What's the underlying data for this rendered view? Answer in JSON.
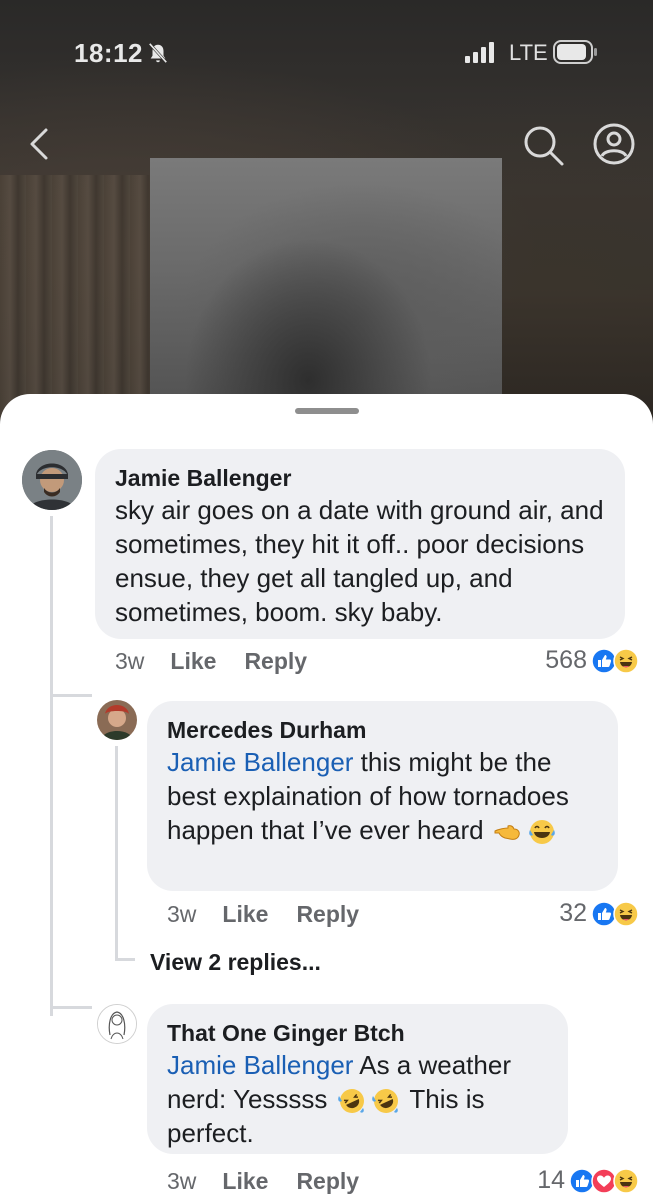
{
  "status_bar": {
    "time": "18:12",
    "network": "LTE",
    "icons": [
      "bell-muted-icon",
      "signal-icon",
      "battery-icon"
    ]
  },
  "top_nav": {
    "icons": [
      "back-chevron-icon",
      "search-icon",
      "profile-icon"
    ]
  },
  "comments": [
    {
      "author": "Jamie Ballenger",
      "text": "sky air goes on a date with ground air, and sometimes, they hit it off.. poor decisions ensue, they get all tangled up, and sometimes, boom. sky baby.",
      "age": "3w",
      "like_label": "Like",
      "reply_label": "Reply",
      "reaction_count": "568",
      "reactions": [
        "like-reaction-icon",
        "haha-reaction-icon"
      ]
    },
    {
      "author": "Mercedes Durham",
      "mention": "Jamie Ballenger",
      "text": " this might be the best explaination of how tornadoes happen that I’ve ever heard ",
      "emojis": [
        "pointing-hand-emoji",
        "tears-of-joy-emoji"
      ],
      "age": "3w",
      "like_label": "Like",
      "reply_label": "Reply",
      "reaction_count": "32",
      "reactions": [
        "like-reaction-icon",
        "haha-reaction-icon"
      ],
      "view_replies_label": "View 2 replies..."
    },
    {
      "author": "That One Ginger Btch",
      "mention": "Jamie Ballenger",
      "text_before": " As a weather nerd: Yesssss ",
      "emojis": [
        "rolling-laughing-emoji",
        "rolling-laughing-emoji"
      ],
      "text_after": " This is perfect.",
      "age": "3w",
      "like_label": "Like",
      "reply_label": "Reply",
      "reaction_count": "14",
      "reactions": [
        "like-reaction-icon",
        "love-reaction-icon",
        "haha-reaction-icon"
      ]
    }
  ],
  "colors": {
    "mention": "#1a5fb4",
    "like_blue": "#1877f2",
    "bubble": "#eff0f3",
    "meta": "#65676b"
  }
}
